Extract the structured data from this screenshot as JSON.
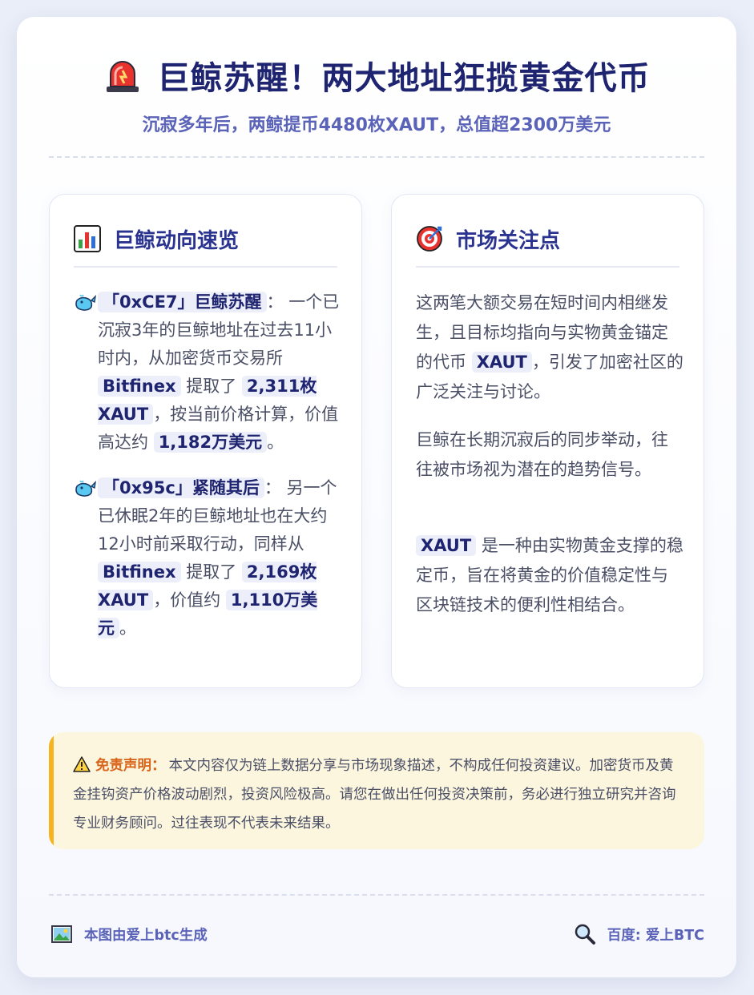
{
  "header": {
    "title": "巨鲸苏醒！两大地址狂揽黄金代币",
    "subtitle": "沉寂多年后，两鲸提币4480枚XAUT，总值超2300万美元",
    "icon": "siren-icon"
  },
  "left_panel": {
    "title": "巨鲸动向速览",
    "icon": "bar-chart-icon",
    "items": [
      {
        "icon": "whale-icon",
        "name": "「0xCE7」巨鲸苏醒",
        "colon": "：",
        "t1": "一个已沉寂3年的巨鲸地址在过去11小时内，从加密货币交易所 ",
        "exchange": "Bitfinex",
        "t2": " 提取了 ",
        "amount": "2,311枚XAUT",
        "t3": "，按当前价格计算，价值高达约 ",
        "value": "1,182万美元",
        "t4": "。"
      },
      {
        "icon": "whale-icon",
        "name": "「0x95c」紧随其后",
        "colon": "：",
        "t1": "另一个已休眠2年的巨鲸地址也在大约12小时前采取行动，同样从 ",
        "exchange": "Bitfinex",
        "t2": " 提取了 ",
        "amount": "2,169枚XAUT",
        "t3": "，价值约 ",
        "value": "1,110万美元",
        "t4": "。"
      }
    ]
  },
  "right_panel": {
    "title": "市场关注点",
    "icon": "target-icon",
    "p1_a": "这两笔大额交易在短时间内相继发生，且目标均指向与实物黄金锚定的代币 ",
    "p1_tag": "XAUT",
    "p1_b": "，引发了加密社区的广泛关注与讨论。",
    "p2": "巨鲸在长期沉寂后的同步举动，往往被市场视为潜在的趋势信号。",
    "p3_tag": "XAUT",
    "p3_b": " 是一种由实物黄金支撑的稳定币，旨在将黄金的价值稳定性与区块链技术的便利性相结合。"
  },
  "disclaimer": {
    "icon": "warning-icon",
    "label": "免责声明：",
    "text": "本文内容仅为链上数据分享与市场现象描述，不构成任何投资建议。加密货币及黄金挂钩资产价格波动剧烈，投资风险极高。请您在做出任何投资决策前，务必进行独立研究并咨询专业财务顾问。过往表现不代表未来结果。"
  },
  "footer": {
    "left_icon": "picture-icon",
    "left_text": "本图由爱上btc生成",
    "right_icon": "magnifier-icon",
    "right_text": "百度: 爱上BTC"
  },
  "colors": {
    "title": "#1e2470",
    "accent": "#5a63b8",
    "warning": "#f5b31f",
    "disclaimer_label": "#d9651a"
  }
}
